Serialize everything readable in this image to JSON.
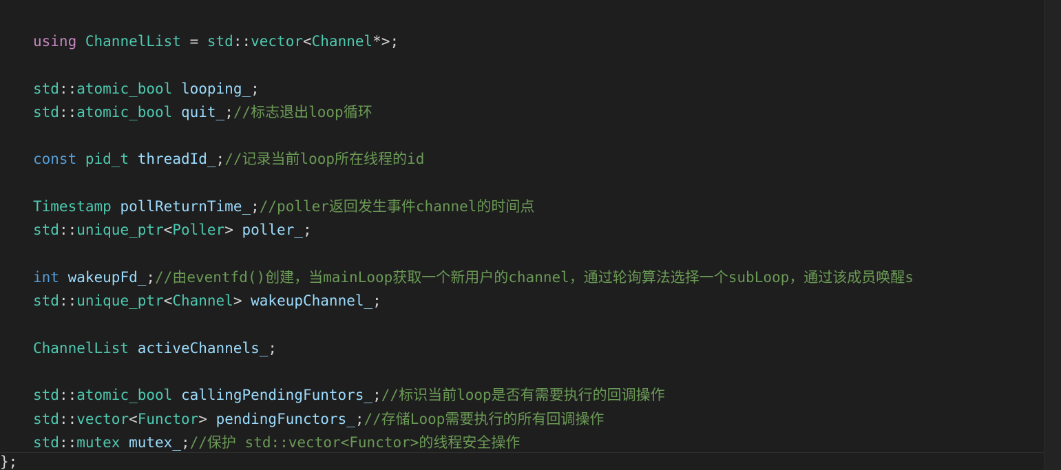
{
  "editor": {
    "lines": [
      {
        "tokens": [
          {
            "t": "using",
            "c": "kw"
          },
          {
            "t": " ",
            "c": "punc"
          },
          {
            "t": "ChannelList",
            "c": "type"
          },
          {
            "t": " = ",
            "c": "punc"
          },
          {
            "t": "std",
            "c": "ns"
          },
          {
            "t": "::",
            "c": "punc"
          },
          {
            "t": "vector",
            "c": "type"
          },
          {
            "t": "<",
            "c": "punc"
          },
          {
            "t": "Channel",
            "c": "type"
          },
          {
            "t": "*>;",
            "c": "punc"
          }
        ]
      },
      {
        "tokens": []
      },
      {
        "tokens": [
          {
            "t": "std",
            "c": "ns"
          },
          {
            "t": "::",
            "c": "punc"
          },
          {
            "t": "atomic_bool",
            "c": "type"
          },
          {
            "t": " ",
            "c": "punc"
          },
          {
            "t": "looping_",
            "c": "var"
          },
          {
            "t": ";",
            "c": "punc"
          }
        ]
      },
      {
        "tokens": [
          {
            "t": "std",
            "c": "ns"
          },
          {
            "t": "::",
            "c": "punc"
          },
          {
            "t": "atomic_bool",
            "c": "type"
          },
          {
            "t": " ",
            "c": "punc"
          },
          {
            "t": "quit_",
            "c": "var"
          },
          {
            "t": ";",
            "c": "punc"
          },
          {
            "t": "//标志退出loop循环",
            "c": "comment"
          }
        ]
      },
      {
        "tokens": []
      },
      {
        "tokens": [
          {
            "t": "const",
            "c": "kw-blue"
          },
          {
            "t": " ",
            "c": "punc"
          },
          {
            "t": "pid_t",
            "c": "type"
          },
          {
            "t": " ",
            "c": "punc"
          },
          {
            "t": "threadId_",
            "c": "var"
          },
          {
            "t": ";",
            "c": "punc"
          },
          {
            "t": "//记录当前loop所在线程的id",
            "c": "comment"
          }
        ]
      },
      {
        "tokens": []
      },
      {
        "tokens": [
          {
            "t": "Timestamp",
            "c": "type"
          },
          {
            "t": " ",
            "c": "punc"
          },
          {
            "t": "pollReturnTime_",
            "c": "var"
          },
          {
            "t": ";",
            "c": "punc"
          },
          {
            "t": "//poller返回发生事件channel的时间点",
            "c": "comment"
          }
        ]
      },
      {
        "tokens": [
          {
            "t": "std",
            "c": "ns"
          },
          {
            "t": "::",
            "c": "punc"
          },
          {
            "t": "unique_ptr",
            "c": "type"
          },
          {
            "t": "<",
            "c": "punc"
          },
          {
            "t": "Poller",
            "c": "type"
          },
          {
            "t": "> ",
            "c": "punc"
          },
          {
            "t": "poller_",
            "c": "var"
          },
          {
            "t": ";",
            "c": "punc"
          }
        ]
      },
      {
        "tokens": []
      },
      {
        "tokens": [
          {
            "t": "int",
            "c": "kw-blue"
          },
          {
            "t": " ",
            "c": "punc"
          },
          {
            "t": "wakeupFd_",
            "c": "var"
          },
          {
            "t": ";",
            "c": "punc"
          },
          {
            "t": "//由eventfd()创建，当mainLoop获取一个新用户的channel，通过轮询算法选择一个subLoop，通过该成员唤醒s",
            "c": "comment"
          }
        ]
      },
      {
        "tokens": [
          {
            "t": "std",
            "c": "ns"
          },
          {
            "t": "::",
            "c": "punc"
          },
          {
            "t": "unique_ptr",
            "c": "type"
          },
          {
            "t": "<",
            "c": "punc"
          },
          {
            "t": "Channel",
            "c": "type"
          },
          {
            "t": "> ",
            "c": "punc"
          },
          {
            "t": "wakeupChannel_",
            "c": "var"
          },
          {
            "t": ";",
            "c": "punc"
          }
        ]
      },
      {
        "tokens": []
      },
      {
        "tokens": [
          {
            "t": "ChannelList",
            "c": "type"
          },
          {
            "t": " ",
            "c": "punc"
          },
          {
            "t": "activeChannels_",
            "c": "var"
          },
          {
            "t": ";",
            "c": "punc"
          }
        ]
      },
      {
        "tokens": []
      },
      {
        "tokens": [
          {
            "t": "std",
            "c": "ns"
          },
          {
            "t": "::",
            "c": "punc"
          },
          {
            "t": "atomic_bool",
            "c": "type"
          },
          {
            "t": " ",
            "c": "punc"
          },
          {
            "t": "callingPendingFuntors_",
            "c": "var"
          },
          {
            "t": ";",
            "c": "punc"
          },
          {
            "t": "//标识当前loop是否有需要执行的回调操作",
            "c": "comment"
          }
        ]
      },
      {
        "tokens": [
          {
            "t": "std",
            "c": "ns"
          },
          {
            "t": "::",
            "c": "punc"
          },
          {
            "t": "vector",
            "c": "type"
          },
          {
            "t": "<",
            "c": "punc"
          },
          {
            "t": "Functor",
            "c": "type"
          },
          {
            "t": "> ",
            "c": "punc"
          },
          {
            "t": "pendingFunctors_",
            "c": "var"
          },
          {
            "t": ";",
            "c": "punc"
          },
          {
            "t": "//存储Loop需要执行的所有回调操作",
            "c": "comment"
          }
        ]
      },
      {
        "tokens": [
          {
            "t": "std",
            "c": "ns"
          },
          {
            "t": "::",
            "c": "punc"
          },
          {
            "t": "mutex",
            "c": "type"
          },
          {
            "t": " ",
            "c": "punc"
          },
          {
            "t": "mutex_",
            "c": "var"
          },
          {
            "t": ";",
            "c": "punc"
          },
          {
            "t": "//保护 std::vector<Functor>的线程安全操作",
            "c": "comment"
          }
        ]
      }
    ],
    "closing_text": "};"
  },
  "colors": {
    "background": "#1e1e1e",
    "keyword": "#c586c0",
    "keyword_blue": "#569cd6",
    "type": "#4ec9b0",
    "variable": "#9cdcfe",
    "comment": "#6a9955",
    "punctuation": "#d4d4d4"
  }
}
